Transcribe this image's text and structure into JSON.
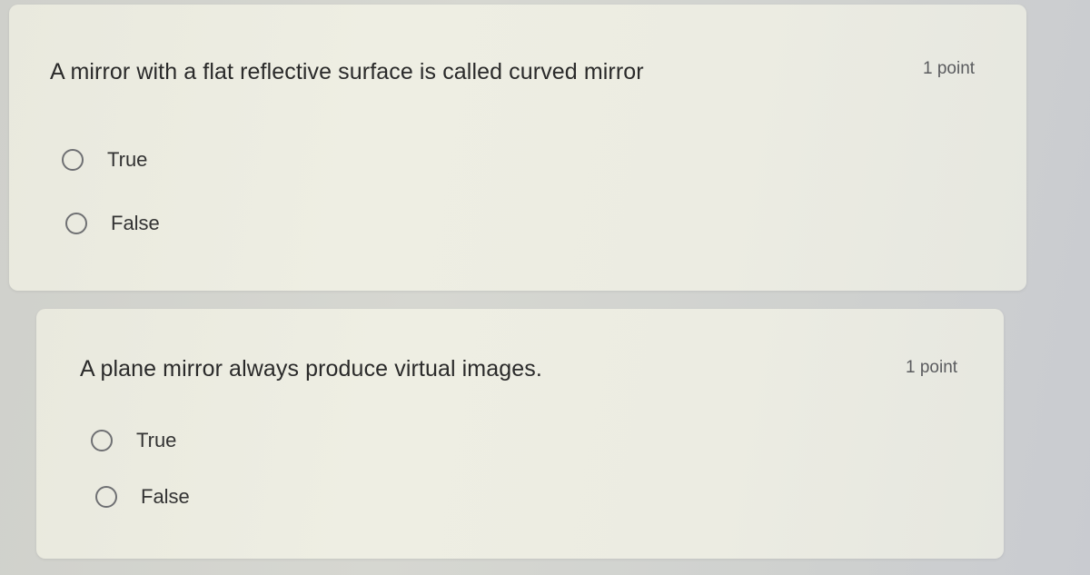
{
  "questions": [
    {
      "text": "A mirror with a flat reflective surface is called curved mirror",
      "points": "1 point",
      "options": [
        {
          "label": "True"
        },
        {
          "label": "False"
        }
      ]
    },
    {
      "text": "A plane mirror always produce virtual images.",
      "points": "1 point",
      "options": [
        {
          "label": "True"
        },
        {
          "label": "False"
        }
      ]
    }
  ]
}
